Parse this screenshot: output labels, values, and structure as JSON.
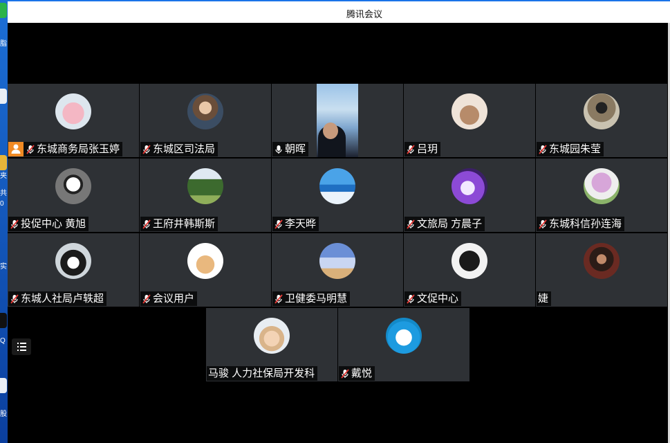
{
  "window": {
    "title": "腾讯会议"
  },
  "desktop_glyphs": [
    "脂",
    "夹",
    "共",
    "0",
    "实",
    "Q",
    "股"
  ],
  "colors": {
    "tile_bg": "#2e3135",
    "host_badge": "#f08a24",
    "title_accent": "#1a73e8"
  },
  "participants": [
    {
      "name": "东城商务局张玉婷",
      "mic": "muted",
      "host": true
    },
    {
      "name": "东城区司法局",
      "mic": "muted"
    },
    {
      "name": "朝晖",
      "mic": "on",
      "video": true
    },
    {
      "name": "吕玥",
      "mic": "muted"
    },
    {
      "name": "东城园朱莹",
      "mic": "muted"
    },
    {
      "name": "投促中心 黄旭",
      "mic": "muted"
    },
    {
      "name": "王府井韩斯斯",
      "mic": "muted"
    },
    {
      "name": "李天晔",
      "mic": "muted"
    },
    {
      "name": " 文旅局 方晨子",
      "mic": "muted"
    },
    {
      "name": "东城科信孙连海",
      "mic": "muted"
    },
    {
      "name": "东城人社局卢轶超",
      "mic": "muted"
    },
    {
      "name": "会议用户",
      "mic": "muted"
    },
    {
      "name": "卫健委马明慧",
      "mic": "muted"
    },
    {
      "name": "文促中心",
      "mic": "muted"
    },
    {
      "name": "婕",
      "mic": "none"
    },
    {
      "name": "马骏 人力社保局开发科",
      "mic": "none"
    },
    {
      "name": "戴悦",
      "mic": "muted"
    }
  ],
  "icons": {
    "menu": "list-icon",
    "host": "user-icon",
    "mic_muted": "mic-muted-icon",
    "mic_on": "mic-icon"
  }
}
